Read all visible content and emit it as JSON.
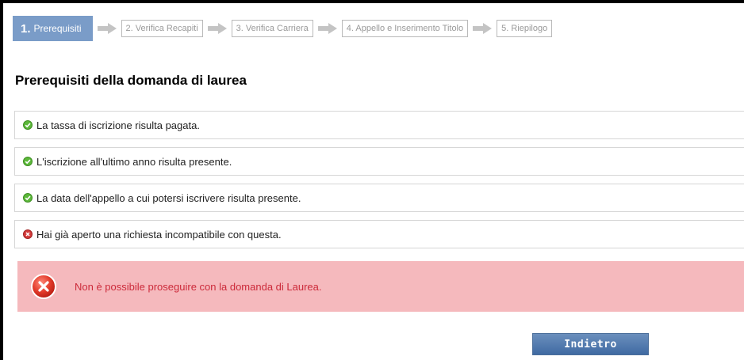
{
  "wizard": {
    "active_step": {
      "num": "1.",
      "label": "Prerequisiti"
    },
    "steps": [
      "2. Verifica Recapiti",
      "3. Verifica Carriera",
      "4. Appello e Inserimento Titolo",
      "5. Riepilogo"
    ]
  },
  "page": {
    "title": "Prerequisiti della domanda di laurea"
  },
  "checks": [
    {
      "status": "ok",
      "icon": "check-circle-icon",
      "text": "La tassa di iscrizione risulta pagata."
    },
    {
      "status": "ok",
      "icon": "check-circle-icon",
      "text": "L'iscrizione all'ultimo anno risulta presente."
    },
    {
      "status": "ok",
      "icon": "check-circle-icon",
      "text": "La data dell'appello a cui potersi iscrivere risulta presente."
    },
    {
      "status": "error",
      "icon": "error-circle-icon",
      "text": "Hai già aperto una richiesta incompatibile con questa."
    }
  ],
  "error": {
    "icon": "error-x-icon",
    "message": "Non è possibile proseguire con la domanda di Laurea."
  },
  "actions": {
    "back_label": "Indietro"
  },
  "colors": {
    "active_step_bg": "#7a9cc8",
    "ok_green": "#5cb83a",
    "error_red": "#d23a3a",
    "error_bg": "#f5b9bd",
    "error_text": "#cc2a3a",
    "button_blue": "#3f6aa2"
  }
}
